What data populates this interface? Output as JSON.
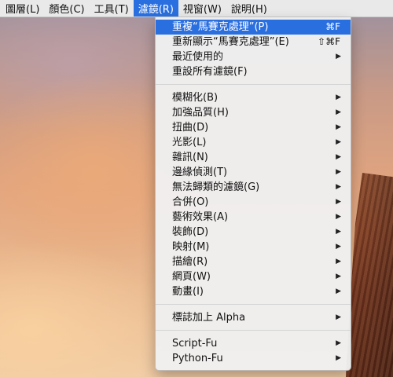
{
  "menubar": {
    "items": [
      {
        "label": "圖層(L)",
        "active": false
      },
      {
        "label": "顏色(C)",
        "active": false
      },
      {
        "label": "工具(T)",
        "active": false
      },
      {
        "label": "濾鏡(R)",
        "active": true
      },
      {
        "label": "視窗(W)",
        "active": false
      },
      {
        "label": "說明(H)",
        "active": false
      }
    ]
  },
  "filters_menu": {
    "group1": [
      {
        "label": "重複“馬賽克處理”(P)",
        "shortcut": "⌘F",
        "highlighted": true
      },
      {
        "label": "重新顯示“馬賽克處理”(E)",
        "shortcut": "⇧⌘F"
      },
      {
        "label": "最近使用的",
        "submenu": true
      },
      {
        "label": "重設所有濾鏡(F)"
      }
    ],
    "group2": [
      {
        "label": "模糊化(B)",
        "submenu": true
      },
      {
        "label": "加強品質(H)",
        "submenu": true
      },
      {
        "label": "扭曲(D)",
        "submenu": true
      },
      {
        "label": "光影(L)",
        "submenu": true
      },
      {
        "label": "雜訊(N)",
        "submenu": true
      },
      {
        "label": "邊緣偵測(T)",
        "submenu": true
      },
      {
        "label": "無法歸類的濾鏡(G)",
        "submenu": true
      },
      {
        "label": "合併(O)",
        "submenu": true
      },
      {
        "label": "藝術效果(A)",
        "submenu": true
      },
      {
        "label": "裝飾(D)",
        "submenu": true
      },
      {
        "label": "映射(M)",
        "submenu": true
      },
      {
        "label": "描繪(R)",
        "submenu": true
      },
      {
        "label": "網頁(W)",
        "submenu": true
      },
      {
        "label": "動畫(I)",
        "submenu": true
      }
    ],
    "group3": [
      {
        "label": "標誌加上 Alpha",
        "submenu": true
      }
    ],
    "group4": [
      {
        "label": "Script-Fu",
        "submenu": true
      },
      {
        "label": "Python-Fu",
        "submenu": true
      }
    ],
    "submenu_arrow": "▶"
  },
  "colors": {
    "highlight": "#2a6fe0",
    "menubar_bg": "#ececec",
    "menu_bg": "#f0f0f0"
  }
}
